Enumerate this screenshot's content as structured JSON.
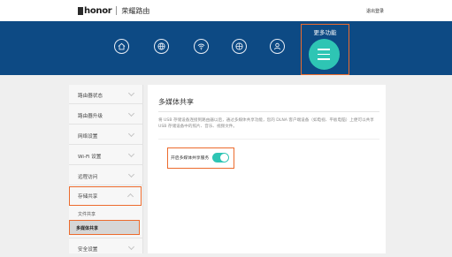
{
  "header": {
    "brand_logo": "honor",
    "product_name": "荣耀路由",
    "logout_label": "退出登录"
  },
  "nav": {
    "icons": [
      "home-icon",
      "internet-globe-icon",
      "wifi-icon",
      "network-globe-icon",
      "user-icon"
    ],
    "more_label": "更多功能",
    "more_icon": "menu-icon"
  },
  "sidebar": {
    "items": [
      {
        "label": "路由器状态"
      },
      {
        "label": "路由器升级"
      },
      {
        "label": "网络设置"
      },
      {
        "label": "Wi-Fi 设置"
      },
      {
        "label": "远程访问"
      },
      {
        "label": "存储共享"
      },
      {
        "label": "安全设置"
      }
    ],
    "sub_items": [
      {
        "label": "文件共享"
      },
      {
        "label": "多媒体共享"
      }
    ]
  },
  "main": {
    "title": "多媒体共享",
    "description": "将 USB 存储设备连接到路由器以后，通过多媒体共享功能，您的 DLNA 客户端设备（如电视、平板电脑）上便可以共享 USB 存储设备中的照片、音乐、视频文件。",
    "toggle": {
      "label": "开启多媒体共享服务",
      "state": "on"
    }
  },
  "colors": {
    "nav_background": "#0d4a84",
    "accent_teal": "#2ec5b4",
    "highlight_orange": "#ec6b2d"
  }
}
